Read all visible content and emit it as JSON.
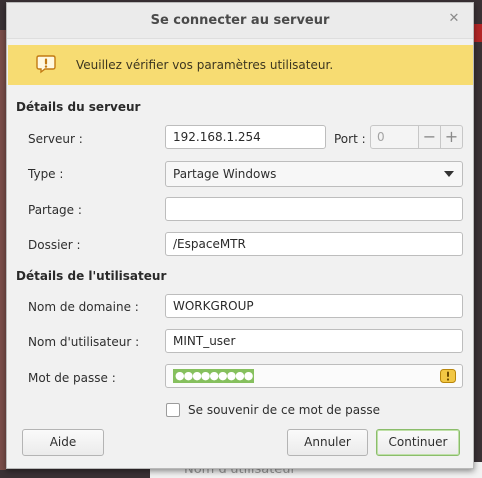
{
  "window": {
    "title": "Se connecter au serveur",
    "close_glyph": "✕"
  },
  "infobar": {
    "message": "Veuillez vérifier vos paramètres utilisateur.",
    "icon": "warning-icon",
    "color": "#f7dc72"
  },
  "server_section": {
    "title": "Détails du serveur",
    "server_label": "Serveur :",
    "server_value": "192.168.1.254",
    "port_label": "Port :",
    "port_value": "0",
    "minus": "−",
    "plus": "+",
    "type_label": "Type :",
    "type_value": "Partage Windows",
    "share_label": "Partage :",
    "share_value": "",
    "folder_label": "Dossier :",
    "folder_value": "/EspaceMTR"
  },
  "user_section": {
    "title": "Détails de l'utilisateur",
    "domain_label": "Nom de domaine :",
    "domain_value": "WORKGROUP",
    "username_label": "Nom d'utilisateur :",
    "username_value": "MINT_user",
    "password_label": "Mot de passe :",
    "password_mask": "●●●●●●●●●",
    "remember_label": "Se souvenir de ce mot de passe",
    "remember_checked": false
  },
  "buttons": {
    "help": "Aide",
    "cancel": "Annuler",
    "connect": "Continuer"
  },
  "background": {
    "partial_text": "Nom d'utilisateur"
  },
  "accent_colors": {
    "selection": "#86c05e",
    "default_button": "#8bbd6b"
  }
}
